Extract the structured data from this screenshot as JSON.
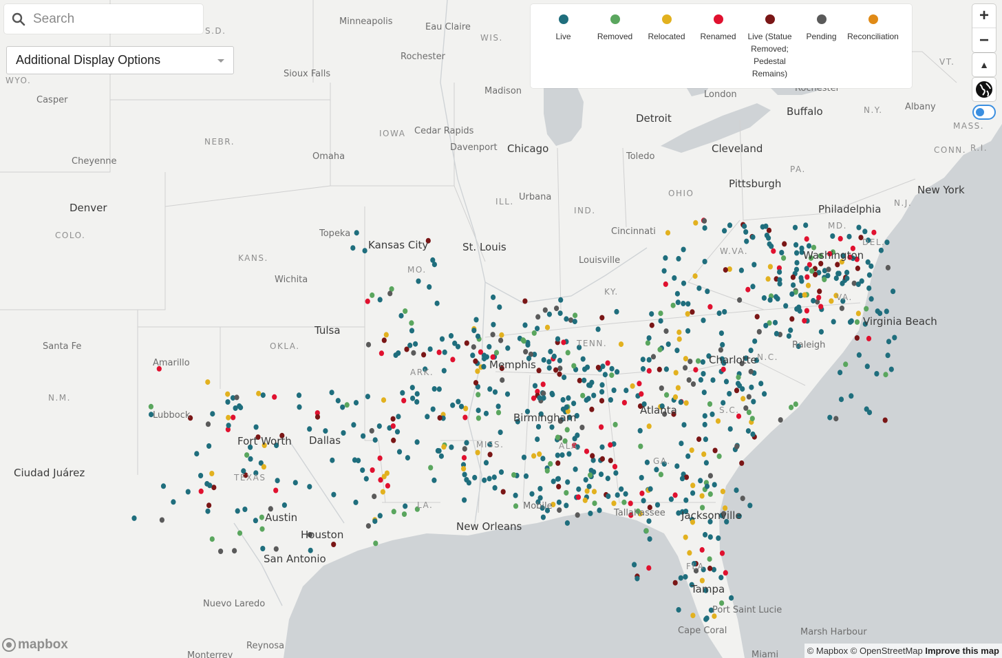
{
  "search": {
    "placeholder": "Search"
  },
  "display_options": {
    "label": "Additional Display Options"
  },
  "legend": [
    {
      "label": "Live",
      "color": "#1f6e7d"
    },
    {
      "label": "Removed",
      "color": "#5aa65e"
    },
    {
      "label": "Relocated",
      "color": "#e2b11f"
    },
    {
      "label": "Renamed",
      "color": "#e0112f"
    },
    {
      "label": "Live (Statue Removed; Pedestal Remains)",
      "color": "#7a1616"
    },
    {
      "label": "Pending",
      "color": "#5a5a5a"
    },
    {
      "label": "Reconciliation",
      "color": "#e08a16"
    }
  ],
  "controls": {
    "zoom_in": "+",
    "zoom_out": "−",
    "compass": "▲"
  },
  "attribution": {
    "mapbox": "© Mapbox",
    "osm": "© OpenStreetMap",
    "improve": "Improve this map"
  },
  "logo": "mapbox",
  "cities": [
    "Minneapolis",
    "Eau Claire",
    "Rochester",
    "Sioux Falls",
    "Madison",
    "Detroit",
    "London",
    "Buffalo",
    "Albany",
    "Casper",
    "Cheyenne",
    "Denver",
    "Cedar Rapids",
    "Davenport",
    "Chicago",
    "Omaha",
    "Toledo",
    "Cleveland",
    "Pittsburgh",
    "Urbana",
    "New York",
    "Philadelphia",
    "Topeka",
    "Kansas City",
    "St. Louis",
    "Cincinnati",
    "Louisville",
    "Washington",
    "Wichita",
    "Virginia Beach",
    "Santa Fe",
    "Tulsa",
    "Amarillo",
    "Memphis",
    "Charlotte",
    "Raleigh",
    "Lubbock",
    "Atlanta",
    "Birmingham",
    "Fort Worth",
    "Dallas",
    "Ciudad Juárez",
    "Austin",
    "Houston",
    "San Antonio",
    "New Orleans",
    "Mobile",
    "Tallahassee",
    "Jacksonville",
    "Tampa",
    "Port Saint Lucie",
    "Nuevo Laredo",
    "Cape Coral",
    "Marsh Harbour",
    "Miami",
    "Reynosa",
    "Monterrey",
    "Rochester"
  ],
  "states": [
    "S.D.",
    "WIS.",
    "VT.",
    "N.Y.",
    "MASS.",
    "R.I.",
    "CONN.",
    "WYO.",
    "NEBR.",
    "IOWA",
    "PA.",
    "N.J.",
    "MD.",
    "DEL.",
    "COLO.",
    "ILL.",
    "IND.",
    "OHIO",
    "W.VA.",
    "KANS.",
    "MO.",
    "KY.",
    "OKLA.",
    "TENN.",
    "N.C.",
    "ARK.",
    "S.C.",
    "N.M.",
    "MISS.",
    "ALA.",
    "GA.",
    "TEXAS",
    "LA.",
    "FLA.",
    "VA."
  ]
}
